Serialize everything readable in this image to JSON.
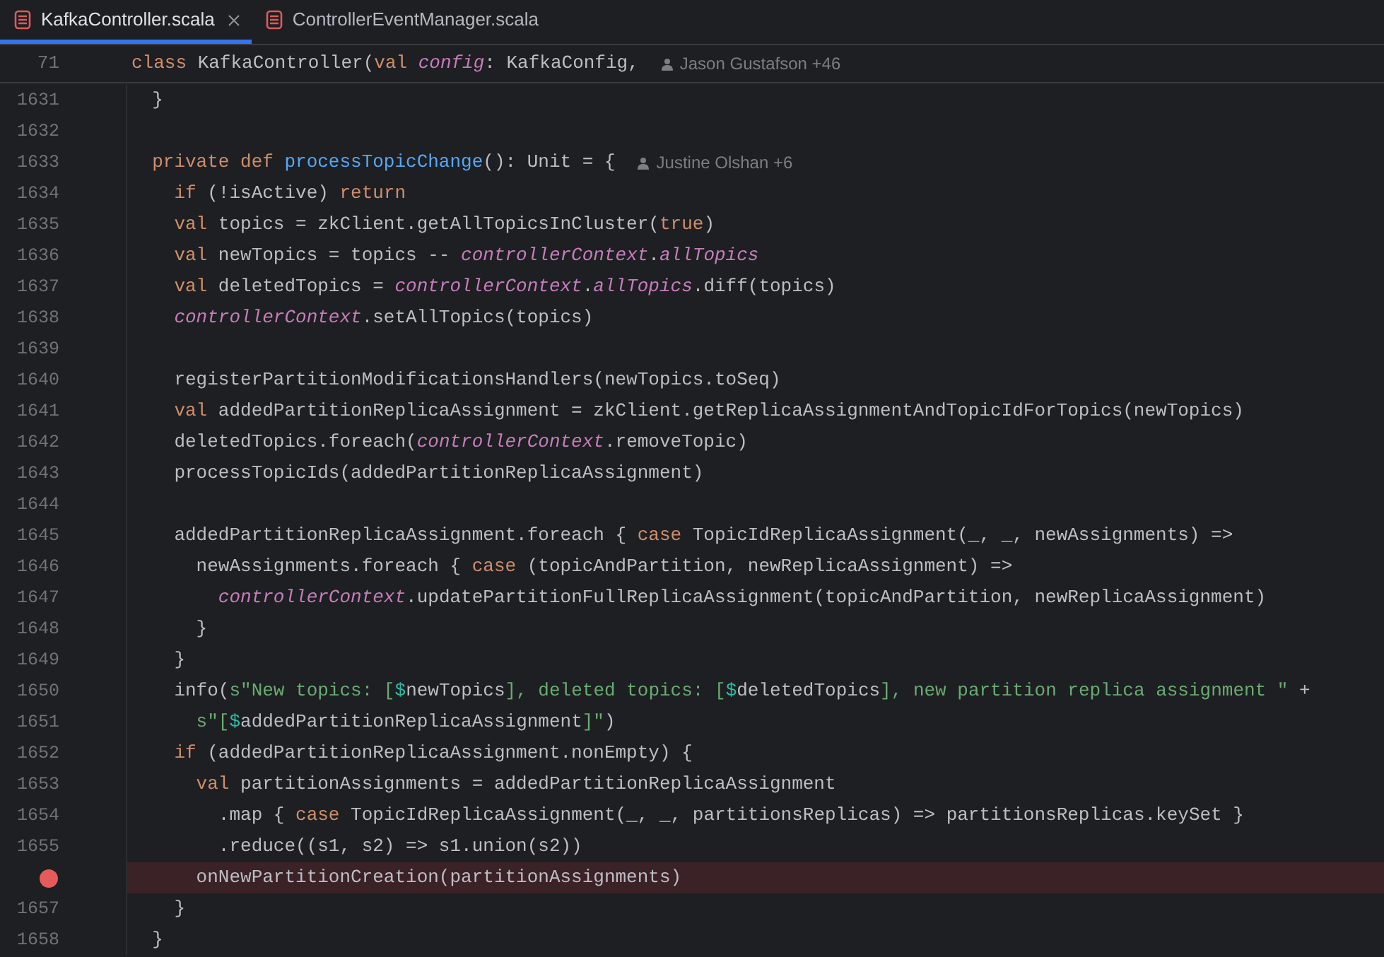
{
  "tabs": [
    {
      "label": "KafkaController.scala",
      "selected": true
    },
    {
      "label": "ControllerEventManager.scala",
      "selected": false
    }
  ],
  "sticky_line": {
    "number": "71",
    "tokens": [
      {
        "kind": "keyword",
        "text": "class"
      },
      {
        "kind": "plain",
        "text": " KafkaController("
      },
      {
        "kind": "keyword",
        "text": "val"
      },
      {
        "kind": "member",
        "text": " config"
      },
      {
        "kind": "plain",
        "text": ": KafkaConfig,"
      }
    ],
    "author": "Jason Gustafson +46"
  },
  "lines": [
    {
      "number": "1631",
      "tokens": [
        {
          "kind": "plain",
          "text": "  }"
        }
      ]
    },
    {
      "number": "1632"
    },
    {
      "number": "1633",
      "tokens": [
        {
          "kind": "keyword",
          "text": "  private def "
        },
        {
          "kind": "function",
          "text": "processTopicChange"
        },
        {
          "kind": "plain",
          "text": "(): Unit = {"
        }
      ],
      "author": "Justine Olshan +6"
    },
    {
      "number": "1634",
      "tokens": [
        {
          "kind": "keyword",
          "text": "    if"
        },
        {
          "kind": "plain",
          "text": " (!isActive) "
        },
        {
          "kind": "keyword",
          "text": "return"
        }
      ]
    },
    {
      "number": "1635",
      "tokens": [
        {
          "kind": "keyword",
          "text": "    val"
        },
        {
          "kind": "plain",
          "text": " topics = zkClient.getAllTopicsInCluster("
        },
        {
          "kind": "keyword",
          "text": "true"
        },
        {
          "kind": "plain",
          "text": ")"
        }
      ]
    },
    {
      "number": "1636",
      "tokens": [
        {
          "kind": "keyword",
          "text": "    val"
        },
        {
          "kind": "plain",
          "text": " newTopics = topics -- "
        },
        {
          "kind": "member",
          "text": "controllerContext"
        },
        {
          "kind": "plain",
          "text": "."
        },
        {
          "kind": "member",
          "text": "allTopics"
        }
      ]
    },
    {
      "number": "1637",
      "tokens": [
        {
          "kind": "keyword",
          "text": "    val"
        },
        {
          "kind": "plain",
          "text": " deletedTopics = "
        },
        {
          "kind": "member",
          "text": "controllerContext"
        },
        {
          "kind": "plain",
          "text": "."
        },
        {
          "kind": "member",
          "text": "allTopics"
        },
        {
          "kind": "plain",
          "text": ".diff(topics)"
        }
      ]
    },
    {
      "number": "1638",
      "tokens": [
        {
          "kind": "member",
          "text": "    controllerContext"
        },
        {
          "kind": "plain",
          "text": ".setAllTopics(topics)"
        }
      ]
    },
    {
      "number": "1639"
    },
    {
      "number": "1640",
      "tokens": [
        {
          "kind": "plain",
          "text": "    registerPartitionModificationsHandlers(newTopics.toSeq)"
        }
      ]
    },
    {
      "number": "1641",
      "tokens": [
        {
          "kind": "keyword",
          "text": "    val"
        },
        {
          "kind": "plain",
          "text": " addedPartitionReplicaAssignment = zkClient.getReplicaAssignmentAndTopicIdForTopics(newTopics)"
        }
      ]
    },
    {
      "number": "1642",
      "tokens": [
        {
          "kind": "plain",
          "text": "    deletedTopics.foreach("
        },
        {
          "kind": "member",
          "text": "controllerContext"
        },
        {
          "kind": "plain",
          "text": ".removeTopic)"
        }
      ]
    },
    {
      "number": "1643",
      "tokens": [
        {
          "kind": "plain",
          "text": "    processTopicIds(addedPartitionReplicaAssignment)"
        }
      ]
    },
    {
      "number": "1644"
    },
    {
      "number": "1645",
      "tokens": [
        {
          "kind": "plain",
          "text": "    addedPartitionReplicaAssignment.foreach { "
        },
        {
          "kind": "keyword",
          "text": "case"
        },
        {
          "kind": "plain",
          "text": " TopicIdReplicaAssignment(_, _, newAssignments) =>"
        }
      ]
    },
    {
      "number": "1646",
      "tokens": [
        {
          "kind": "plain",
          "text": "      newAssignments.foreach { "
        },
        {
          "kind": "keyword",
          "text": "case"
        },
        {
          "kind": "plain",
          "text": " (topicAndPartition, newReplicaAssignment) =>"
        }
      ]
    },
    {
      "number": "1647",
      "tokens": [
        {
          "kind": "member",
          "text": "        controllerContext"
        },
        {
          "kind": "plain",
          "text": ".updatePartitionFullReplicaAssignment(topicAndPartition, newReplicaAssignment)"
        }
      ]
    },
    {
      "number": "1648",
      "tokens": [
        {
          "kind": "plain",
          "text": "      }"
        }
      ]
    },
    {
      "number": "1649",
      "tokens": [
        {
          "kind": "plain",
          "text": "    }"
        }
      ]
    },
    {
      "number": "1650",
      "tokens": [
        {
          "kind": "plain",
          "text": "    info("
        },
        {
          "kind": "string",
          "text": "s\"New topics: ["
        },
        {
          "kind": "interp",
          "text": "$"
        },
        {
          "kind": "plain",
          "text": "newTopics"
        },
        {
          "kind": "string",
          "text": "], deleted topics: ["
        },
        {
          "kind": "interp",
          "text": "$"
        },
        {
          "kind": "plain",
          "text": "deletedTopics"
        },
        {
          "kind": "string",
          "text": "], new partition replica assignment \""
        },
        {
          "kind": "plain",
          "text": " +"
        }
      ]
    },
    {
      "number": "1651",
      "tokens": [
        {
          "kind": "string",
          "text": "      s\"["
        },
        {
          "kind": "interp",
          "text": "$"
        },
        {
          "kind": "plain",
          "text": "addedPartitionReplicaAssignment"
        },
        {
          "kind": "string",
          "text": "]\""
        },
        {
          "kind": "plain",
          "text": ")"
        }
      ]
    },
    {
      "number": "1652",
      "tokens": [
        {
          "kind": "keyword",
          "text": "    if"
        },
        {
          "kind": "plain",
          "text": " (addedPartitionReplicaAssignment.nonEmpty) {"
        }
      ]
    },
    {
      "number": "1653",
      "tokens": [
        {
          "kind": "keyword",
          "text": "      val"
        },
        {
          "kind": "plain",
          "text": " partitionAssignments = addedPartitionReplicaAssignment"
        }
      ]
    },
    {
      "number": "1654",
      "tokens": [
        {
          "kind": "plain",
          "text": "        .map { "
        },
        {
          "kind": "keyword",
          "text": "case"
        },
        {
          "kind": "plain",
          "text": " TopicIdReplicaAssignment(_, _, partitionsReplicas) => partitionsReplicas.keySet }"
        }
      ]
    },
    {
      "number": "1655",
      "tokens": [
        {
          "kind": "plain",
          "text": "        .reduce((s1, s2) => s1.union(s2))"
        }
      ]
    },
    {
      "breakpoint": true,
      "tokens": [
        {
          "kind": "plain",
          "text": "      onNewPartitionCreation(partitionAssignments)"
        }
      ]
    },
    {
      "number": "1657",
      "tokens": [
        {
          "kind": "plain",
          "text": "    }"
        }
      ]
    },
    {
      "number": "1658",
      "tokens": [
        {
          "kind": "plain",
          "text": "  }"
        }
      ]
    }
  ]
}
